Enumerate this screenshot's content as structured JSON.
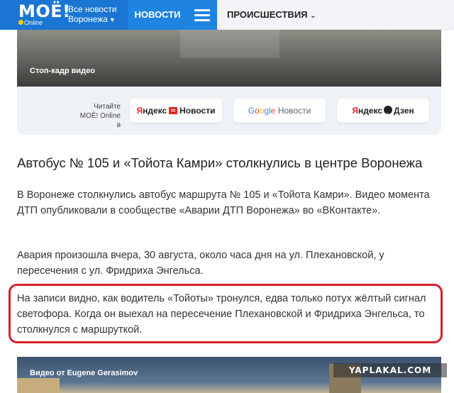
{
  "header": {
    "logo_text": "МОЁ!",
    "logo_sub": "Online",
    "region_line1": "Все новости",
    "region_line2": "Воронежа",
    "nav_news": "НОВОСТИ",
    "nav_incidents": "ПРОИСШЕСТВИЯ"
  },
  "video": {
    "caption": "Стоп-кадр видео"
  },
  "subscribe": {
    "prompt_line1": "Читайте",
    "prompt_line2": "МОЁ! Online в",
    "yandex_news": {
      "part1": "Я",
      "part2": "ндекс",
      "part3": "Новости"
    },
    "google_news": {
      "g": "G",
      "o1": "o",
      "o2": "o",
      "g2": "g",
      "l": "l",
      "e": "e",
      "news": "Новости"
    },
    "yandex_zen": {
      "part1": "Я",
      "part2": "ндекс",
      "part3": "Дзен"
    }
  },
  "article": {
    "headline": "Автобус № 105 и «Тойота Камри» столкнулись в центре Воронежа",
    "paragraph1": "В Воронеже столкнулись автобус маршрута № 105 и «Тойота Камри». Видео момента ДТП опубликовали в сообществе «Аварии ДТП Воронежа» во «ВКонтакте».",
    "paragraph2": "Авария произошла вчера, 30 августа, около часа дня на ул. Плехановской, у пересечения с ул. Фридриха Энгельса.",
    "paragraph3": "На записи видно, как водитель «Тойоты» тронулся, едва только потух жёлтый сигнал светофора. Когда он выехал на пересечение Плехановской и Фридриха Энгельса, то столкнулся с маршруткой."
  },
  "video2": {
    "caption": "Видео от Eugene Gerasimov"
  },
  "watermark": "YAPLAKAL.COM",
  "colors": {
    "brand_blue": "#1a76d2",
    "nav_blue": "#1f84e0",
    "highlight_red": "#d61f2c"
  }
}
